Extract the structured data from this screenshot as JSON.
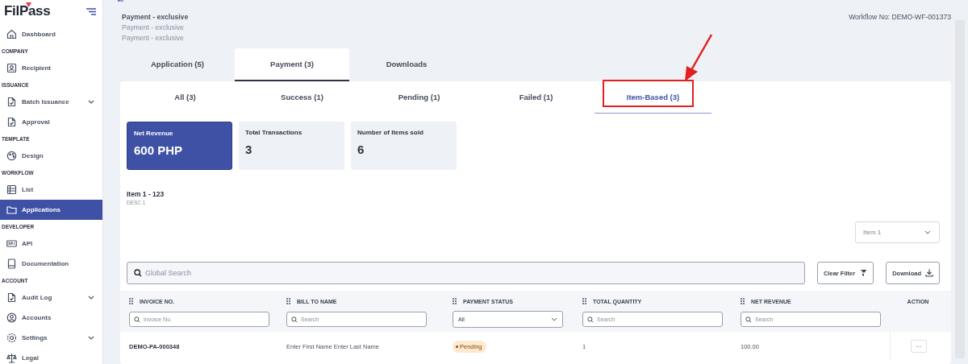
{
  "sidebar": {
    "logo": "FilPass",
    "sections": [
      {
        "items": [
          {
            "kind": "link",
            "label": "Dashboard",
            "selected": false
          }
        ]
      },
      {
        "heading": "COMPANY",
        "items": [
          {
            "kind": "link",
            "label": "Recipient",
            "selected": false
          }
        ]
      },
      {
        "heading": "ISSUANCE",
        "items": [
          {
            "kind": "group",
            "label": "Batch Issuance",
            "selected": false,
            "expanded": false
          },
          {
            "kind": "link",
            "label": "Approval",
            "selected": false
          }
        ]
      },
      {
        "heading": "TEMPLATE",
        "items": [
          {
            "kind": "link",
            "label": "Design",
            "selected": false
          }
        ]
      },
      {
        "heading": "WORKFLOW",
        "items": [
          {
            "kind": "link",
            "label": "List",
            "selected": false
          },
          {
            "kind": "link",
            "label": "Applications",
            "selected": true
          }
        ]
      },
      {
        "heading": "DEVELOPER",
        "items": [
          {
            "kind": "link",
            "label": "API",
            "selected": false
          },
          {
            "kind": "link",
            "label": "Documentation",
            "selected": false
          }
        ]
      },
      {
        "heading": "ACCOUNT",
        "items": [
          {
            "kind": "group",
            "label": "Audit Log",
            "selected": false,
            "expanded": false
          },
          {
            "kind": "link",
            "label": "Accounts",
            "selected": false
          },
          {
            "kind": "group",
            "label": "Settings",
            "selected": false,
            "expanded": false
          },
          {
            "kind": "link",
            "label": "Legal",
            "selected": false
          }
        ]
      }
    ]
  },
  "header": {
    "titles": [
      "Payment - exclusive",
      "Payment - exclusive",
      "Payment - exclusive"
    ],
    "workflow_no": "Workflow No: DEMO-WF-001373"
  },
  "tabs": [
    {
      "label": "Application (5)",
      "selected": false
    },
    {
      "label": "Payment (3)",
      "selected": true
    },
    {
      "label": "Downloads",
      "selected": false
    }
  ],
  "subtabs": [
    {
      "label": "All (3)",
      "selected": false
    },
    {
      "label": "Success (1)",
      "selected": false
    },
    {
      "label": "Pending (1)",
      "selected": false
    },
    {
      "label": "Failed (1)",
      "selected": false
    },
    {
      "label": "Item-Based (3)",
      "selected": true
    }
  ],
  "stats": [
    {
      "label": "Net Revenue",
      "value": "600 PHP",
      "selected": true
    },
    {
      "label": "Total Transactions",
      "value": "3",
      "selected": false
    },
    {
      "label": "Number of Items sold",
      "value": "6",
      "selected": false
    }
  ],
  "item": {
    "title": "Item 1 - 123",
    "description": "DESC 1",
    "selector": "Item 1"
  },
  "toolbar": {
    "search_placeholder": "Global Search",
    "buttons": [
      {
        "kind": "clear",
        "label": "Clear Filter"
      },
      {
        "kind": "download",
        "label": "Download"
      }
    ]
  },
  "table": {
    "columns": [
      {
        "label": "INVOICE NO.",
        "filter": {
          "kind": "search",
          "placeholder": "Invoice No."
        }
      },
      {
        "label": "BILL TO NAME",
        "filter": {
          "kind": "search",
          "placeholder": "Search"
        }
      },
      {
        "label": "PAYMENT STATUS",
        "filter": {
          "kind": "select",
          "value": "All"
        }
      },
      {
        "label": "TOTAL QUANTITY",
        "filter": {
          "kind": "search",
          "placeholder": "Search"
        }
      },
      {
        "label": "NET REVENUE",
        "filter": {
          "kind": "search",
          "placeholder": "Search"
        }
      },
      {
        "label": "ACTION"
      }
    ],
    "rows": [
      {
        "invoice": "DEMO-PA-000348",
        "bill_to": "Enter First Name Enter Last Name",
        "status": {
          "kind": "pending",
          "label": "Pending"
        },
        "quantity": "1",
        "net_revenue": "100.00",
        "action": "···"
      }
    ]
  }
}
